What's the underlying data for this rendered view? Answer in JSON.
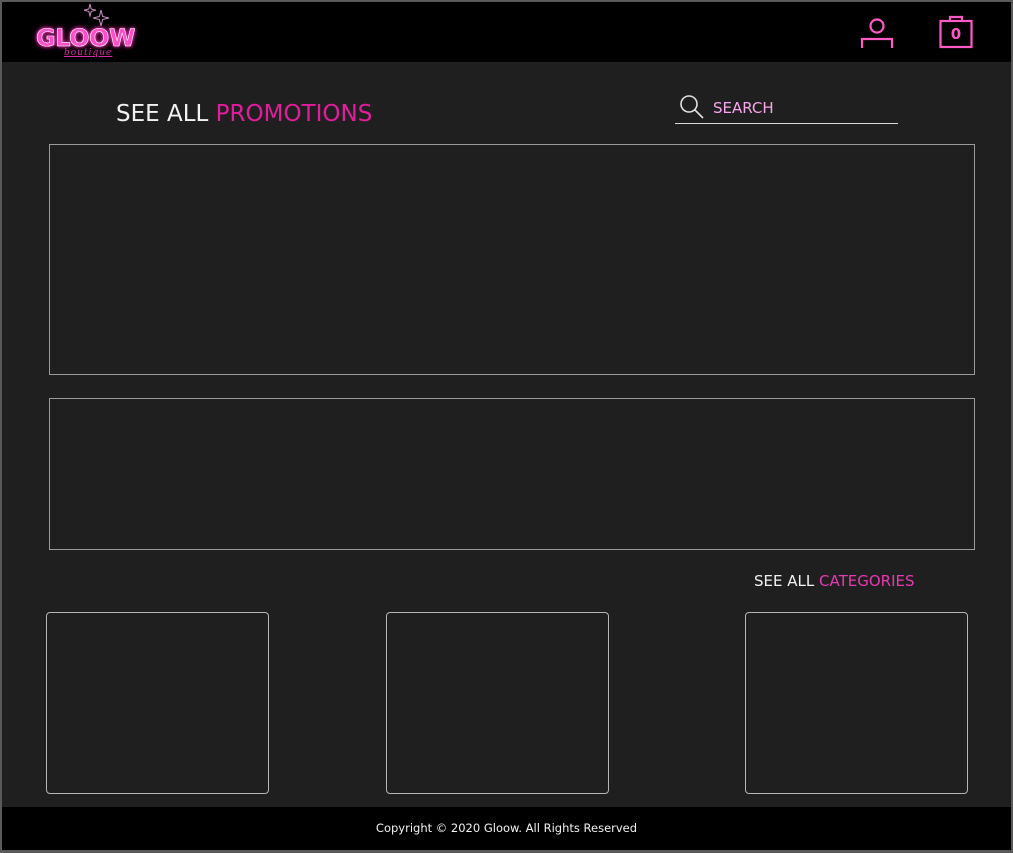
{
  "brand": {
    "name": "GLOOW",
    "tagline": "boutique"
  },
  "header": {
    "user_icon": "user-icon",
    "cart_icon": "shopping-bag-icon",
    "cart_count": "0"
  },
  "promotions": {
    "prefix": "SEE ALL",
    "highlight": "PROMOTIONS"
  },
  "search": {
    "icon": "search-icon",
    "placeholder": "SEARCH"
  },
  "categories": {
    "prefix": "SEE ALL",
    "highlight": "CATEGORIES"
  },
  "footer": {
    "copyright": "Copyright © 2020 Gloow. All Rights Reserved"
  },
  "colors": {
    "background": "#201f20",
    "bar": "#000000",
    "accent": "#e21d9b",
    "icon_pink": "#ff59c6",
    "search_text": "#f7a6ea"
  }
}
